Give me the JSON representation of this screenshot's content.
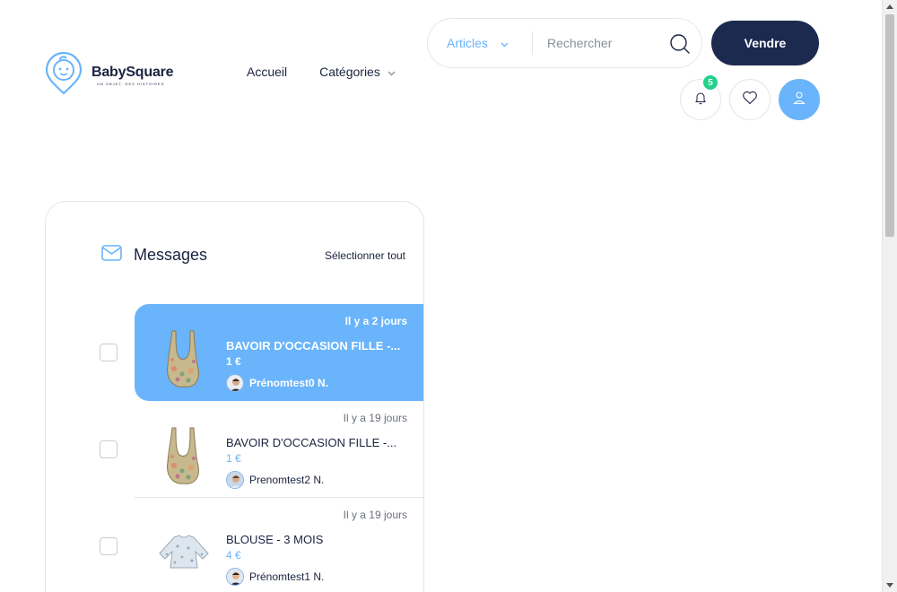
{
  "brand": {
    "name": "BabySquare",
    "tagline": "UN OBJET, DES HISTOIRES",
    "accent": "#69b4fb",
    "navy": "#1d2a4f",
    "badge_color": "#23d18b"
  },
  "nav": [
    {
      "label": "Accueil"
    },
    {
      "label": "Catégories"
    }
  ],
  "search": {
    "category": "Articles",
    "placeholder": "Rechercher",
    "value": ""
  },
  "header": {
    "sell_label": "Vendre",
    "notification_count": "5"
  },
  "messages": {
    "title": "Messages",
    "select_all": "Sélectionner tout",
    "items": [
      {
        "date": "Il y a 2 jours",
        "title": "BAVOIR D'OCCASION FILLE -...",
        "price": "1 €",
        "seller": "Prénomtest0 N.",
        "active": true,
        "image": "bib"
      },
      {
        "date": "Il y a 19 jours",
        "title": "BAVOIR D'OCCASION FILLE -...",
        "price": "1 €",
        "seller": "Prenomtest2 N.",
        "active": false,
        "image": "bib"
      },
      {
        "date": "Il y a 19 jours",
        "title": "BLOUSE - 3 MOIS",
        "price": "4 €",
        "seller": "Prénomtest1 N.",
        "active": false,
        "image": "blouse"
      }
    ]
  }
}
